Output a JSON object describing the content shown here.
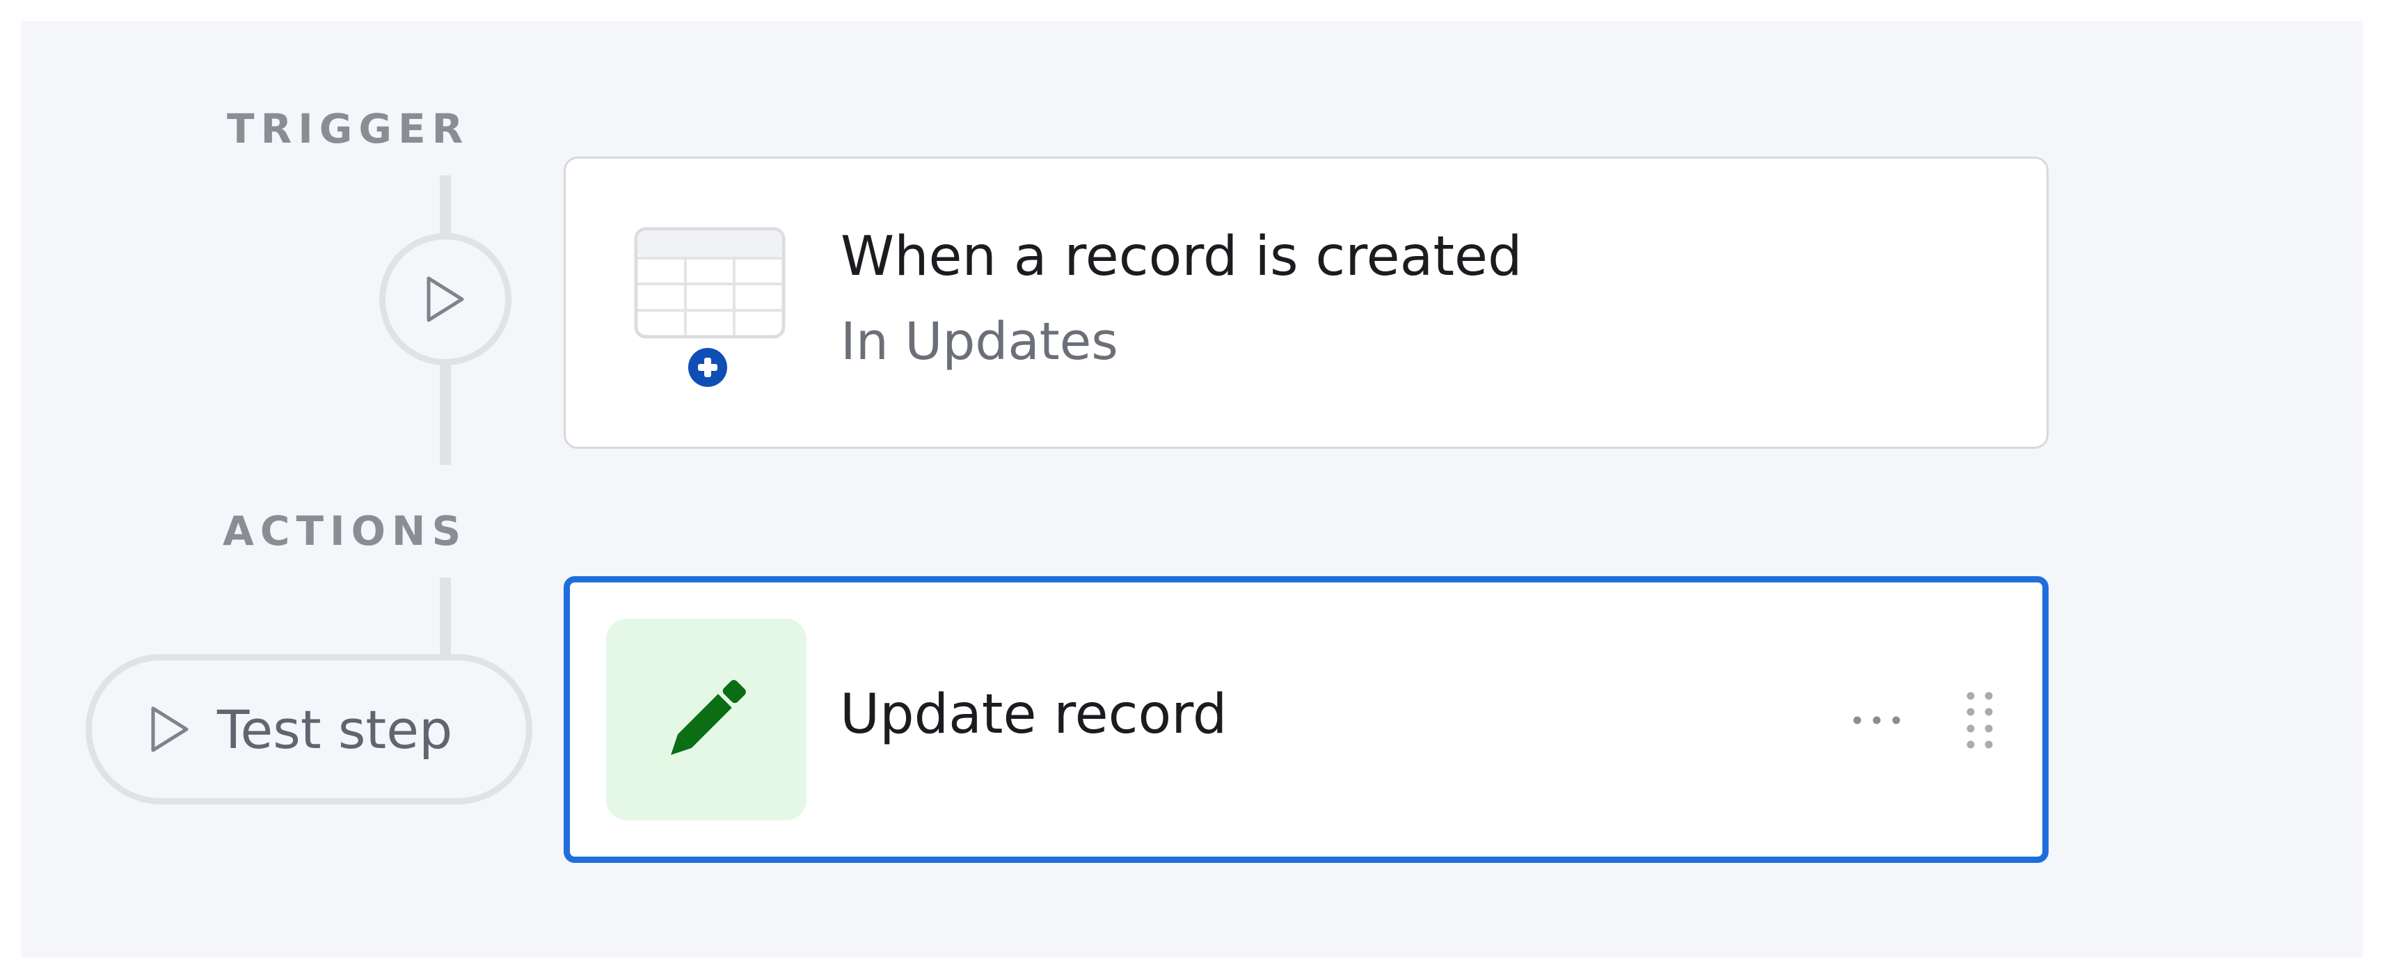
{
  "trigger_section": {
    "label": "TRIGGER",
    "card": {
      "title": "When a record is created",
      "subtitle": "In Updates",
      "icon": "table-add-icon"
    },
    "run_icon": "play-icon"
  },
  "actions_section": {
    "label": "ACTIONS",
    "test_step": {
      "label": "Test step",
      "icon": "play-icon"
    },
    "card": {
      "title": "Update record",
      "icon": "pencil-icon",
      "more_icon": "more-horizontal-icon",
      "drag_icon": "drag-handle-icon"
    }
  },
  "colors": {
    "canvas_bg": "#f5f6f9",
    "selected_border": "#1e6fdc",
    "pencil_green": "#0b6e15",
    "pencil_tile_bg": "#e5f8e6",
    "plus_badge_blue": "#0f4fb5",
    "section_label": "#8a8d94"
  }
}
